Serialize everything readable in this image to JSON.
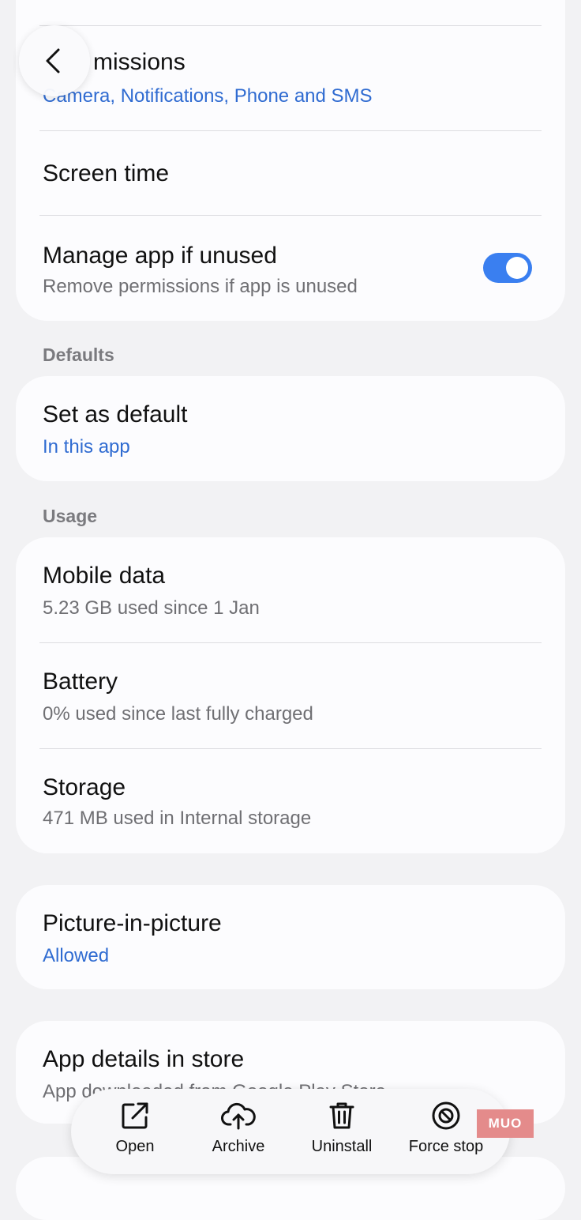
{
  "permissions": {
    "title": "Permissions",
    "title_visible": "missions",
    "subtitle": "Camera, Notifications, Phone and SMS"
  },
  "screen_time": {
    "title": "Screen time"
  },
  "manage_app": {
    "title": "Manage app if unused",
    "subtitle": "Remove permissions if app is unused",
    "toggle_on": true
  },
  "sections": {
    "defaults": "Defaults",
    "usage": "Usage"
  },
  "set_default": {
    "title": "Set as default",
    "subtitle": "In this app"
  },
  "mobile_data": {
    "title": "Mobile data",
    "subtitle": "5.23 GB used since 1 Jan"
  },
  "battery": {
    "title": "Battery",
    "subtitle": "0% used since last fully charged"
  },
  "storage": {
    "title": "Storage",
    "subtitle": "471 MB used in Internal storage"
  },
  "pip": {
    "title": "Picture-in-picture",
    "subtitle": "Allowed"
  },
  "store": {
    "title": "App details in store",
    "subtitle": "App downloaded from Google Play Store"
  },
  "actions": {
    "open": "Open",
    "archive": "Archive",
    "uninstall": "Uninstall",
    "force_stop": "Force stop"
  },
  "watermark": "MUO",
  "colors": {
    "accent_blue": "#2f6bd1",
    "toggle_blue": "#3a7ff0",
    "background": "#f2f2f4",
    "card": "#fcfcfe"
  },
  "icons": {
    "back": "chevron-left-icon",
    "open": "open-external-icon",
    "archive": "cloud-upload-icon",
    "uninstall": "trash-icon",
    "force_stop": "stop-circle-icon"
  }
}
